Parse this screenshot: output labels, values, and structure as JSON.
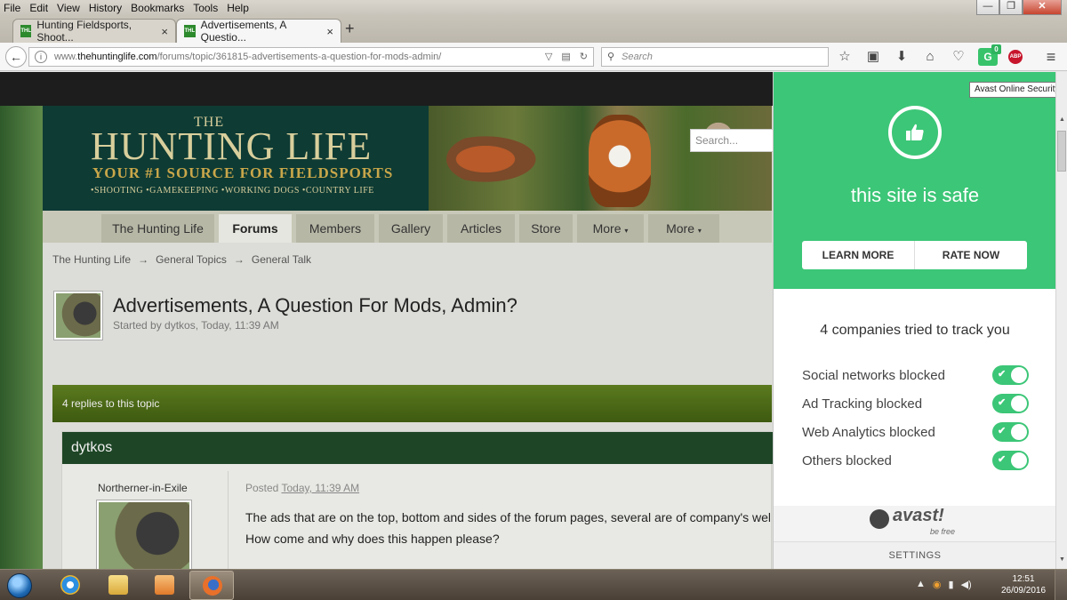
{
  "menubar": {
    "items": [
      "File",
      "Edit",
      "View",
      "History",
      "Bookmarks",
      "Tools",
      "Help"
    ]
  },
  "window_controls": {
    "minimize": "—",
    "maximize": "❐",
    "close": "✕"
  },
  "tabs": [
    {
      "title": "Hunting Fieldsports, Shoot...",
      "favicon": "THL",
      "close": "×"
    },
    {
      "title": "Advertisements, A Questio...",
      "favicon": "THL",
      "close": "×"
    }
  ],
  "new_tab": "+",
  "navbar": {
    "url_prefix": "www.",
    "url_host": "thehuntinglife.com",
    "url_path": "/forums/topic/361815-advertisements-a-question-for-mods-admin/",
    "search_placeholder": "Search"
  },
  "avast_toolbar_count": "0",
  "abp_label": "ABP",
  "tooltip": "Avast Online Security",
  "site": {
    "logo_the": "THE",
    "logo_title": "HUNTING LIFE",
    "logo_subtitle": "YOUR #1 SOURCE FOR FIELDSPORTS",
    "logo_categories": "•SHOOTING  •GAMEKEEPING •WORKING DOGS •COUNTRY LIFE",
    "search_placeholder": "Search...",
    "nav": [
      {
        "label": "The Hunting Life",
        "active": false
      },
      {
        "label": "Forums",
        "active": true
      },
      {
        "label": "Members",
        "active": false
      },
      {
        "label": "Gallery",
        "active": false
      },
      {
        "label": "Articles",
        "active": false
      },
      {
        "label": "Store",
        "active": false
      },
      {
        "label": "More",
        "active": false
      },
      {
        "label": "More",
        "active": false
      }
    ],
    "breadcrumb": [
      "The Hunting Life",
      "General Topics",
      "General Talk"
    ],
    "breadcrumb_sep": "→",
    "topic_title": "Advertisements, A Question For Mods, Admin?",
    "topic_meta": "Started by dytkos, Today, 11:39 AM",
    "replies": "4 replies to this topic",
    "post": {
      "author_header": "dytkos",
      "author_title": "Northerner-in-Exile",
      "posted_label": "Posted",
      "posted_time": "Today, 11:39 AM",
      "text_line1": "The ads that are on the top, bottom and sides of the forum pages, several are of company's web sites that I've",
      "text_line2": "How come and why does this happen please?"
    }
  },
  "avast": {
    "status": "this site is safe",
    "learn_more": "LEARN MORE",
    "rate_now": "RATE NOW",
    "tracking_summary": "4 companies tried to track you",
    "toggles": [
      {
        "label": "Social networks blocked",
        "on": true
      },
      {
        "label": "Ad Tracking blocked",
        "on": true
      },
      {
        "label": "Web Analytics blocked",
        "on": true
      },
      {
        "label": "Others blocked",
        "on": true
      }
    ],
    "logo_text": "avast!",
    "logo_tagline": "be free",
    "settings": "SETTINGS",
    "accent": "#3cc677"
  },
  "taskbar": {
    "time": "12:51",
    "date": "26/09/2016"
  }
}
